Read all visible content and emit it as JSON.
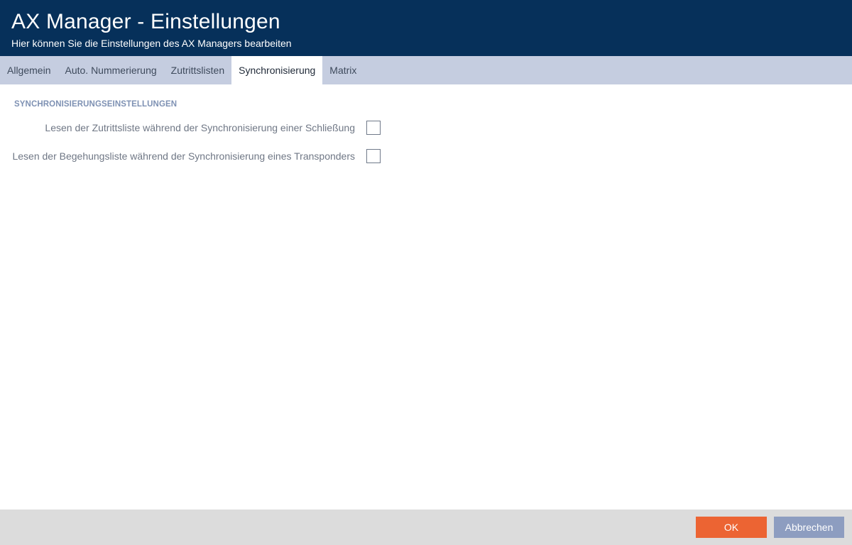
{
  "header": {
    "title": "AX Manager - Einstellungen",
    "subtitle": "Hier können Sie die Einstellungen des AX Managers bearbeiten"
  },
  "tabs": [
    {
      "label": "Allgemein",
      "active": false
    },
    {
      "label": "Auto. Nummerierung",
      "active": false
    },
    {
      "label": "Zutrittslisten",
      "active": false
    },
    {
      "label": "Synchronisierung",
      "active": true
    },
    {
      "label": "Matrix",
      "active": false
    }
  ],
  "section": {
    "title": "SYNCHRONISIERUNGSEINSTELLUNGEN",
    "settings": [
      {
        "label": "Lesen der Zutrittsliste während der Synchronisierung einer Schließung",
        "checked": false
      },
      {
        "label": "Lesen der Begehungsliste während der Synchronisierung eines Transponders",
        "checked": false
      }
    ]
  },
  "footer": {
    "ok_label": "OK",
    "cancel_label": "Abbrechen"
  },
  "colors": {
    "header_bg": "#06305a",
    "tabbar_bg": "#c5cde0",
    "section_title": "#7e91b3",
    "ok_button": "#ec6433",
    "cancel_button": "#8d9dc0",
    "footer_bg": "#dcdcdc"
  }
}
